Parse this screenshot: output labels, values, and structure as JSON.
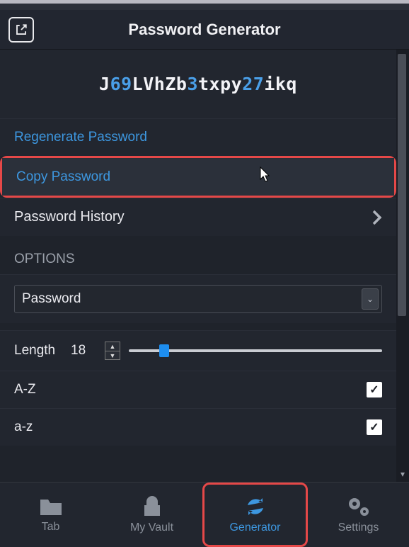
{
  "header": {
    "title": "Password Generator"
  },
  "password": {
    "parts": [
      {
        "t": "J",
        "c": "letter"
      },
      {
        "t": "69",
        "c": "digit"
      },
      {
        "t": "LVhZb",
        "c": "letter"
      },
      {
        "t": "3",
        "c": "digit"
      },
      {
        "t": "txpy",
        "c": "letter"
      },
      {
        "t": "27",
        "c": "digit"
      },
      {
        "t": "ikq",
        "c": "letter"
      }
    ]
  },
  "actions": {
    "regenerate": "Regenerate Password",
    "copy": "Copy Password",
    "history": "Password History"
  },
  "options": {
    "heading": "OPTIONS",
    "type_selected": "Password",
    "length_label": "Length",
    "length_value": "18",
    "upper_label": "A-Z",
    "upper_checked": true,
    "lower_label": "a-z",
    "lower_checked": true
  },
  "nav": {
    "tab": "Tab",
    "vault": "My Vault",
    "generator": "Generator",
    "settings": "Settings"
  }
}
